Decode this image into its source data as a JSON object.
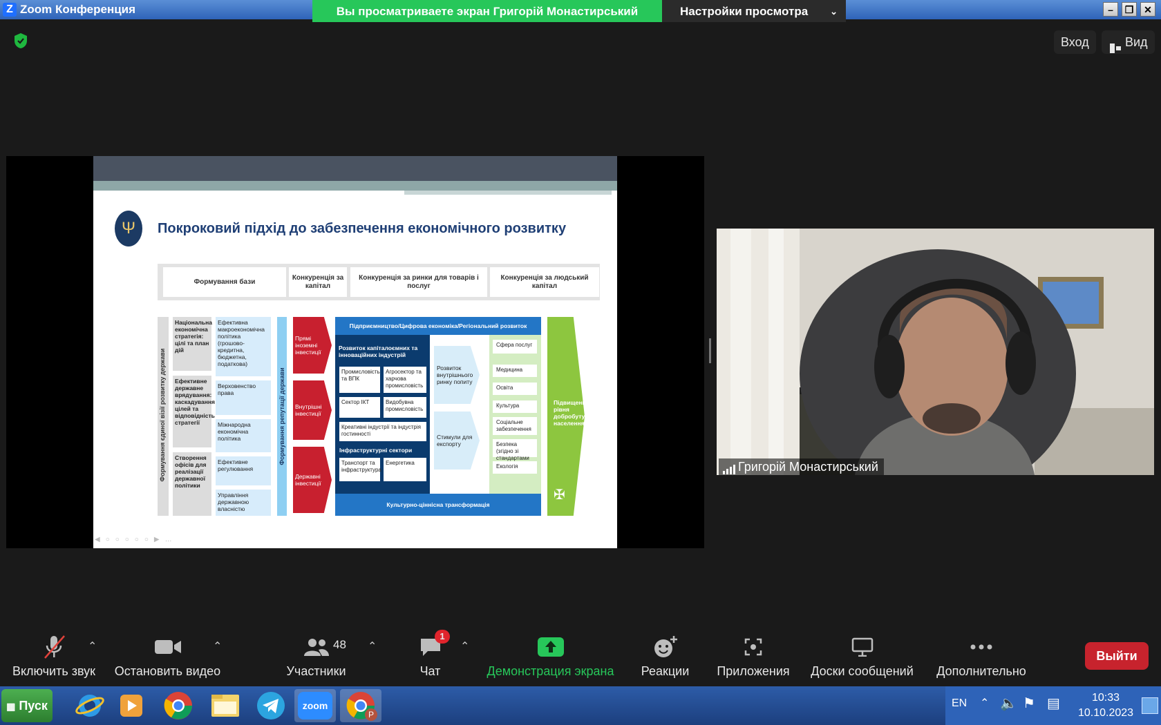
{
  "window": {
    "title": "Zoom Конференция",
    "viewing_banner": "Вы просматриваете экран Григорій Монастирський",
    "view_options": "Настройки просмотра",
    "sign_in": "Вход",
    "view": "Вид"
  },
  "slide": {
    "title": "Покроковий підхід до забезпечення економічного розвитку",
    "stages": [
      "Формування бази",
      "Конкуренція за капітал",
      "Конкуренція за ринки для товарів і послуг",
      "Конкуренція за людський капітал"
    ],
    "left_vertical": "Формування єдиної візії розвитку держави",
    "grey_boxes": [
      "Національна економічна стратегія: цілі та план дій",
      "Ефективне державне врядування: каскадування цілей та відповідність стратегії",
      "Створення офісів для реалізації державної політики"
    ],
    "blue_boxes": [
      "Ефективна макроекономічна політика (грошово-кредитна, бюджетна, податкова)",
      "Верховенство права",
      "Міжнародна економічна політика",
      "Ефективне регулювання",
      "Управління державною власністю"
    ],
    "reputation_vertical": "Формування репутації держави",
    "red_arrows": [
      "Прямі іноземні інвестиції",
      "Внутрішні інвестиції",
      "Державні інвестиції"
    ],
    "header_blue": "Підприємництво/Цифрова економіка/Регіональний розвиток",
    "dev_title": "Розвиток капіталоємних та інноваційних індустрій",
    "dev_boxes": [
      "Промисловість та ВПК",
      "Агросектор та харчова промисловість",
      "Сектор ІКТ",
      "Видобувна промисловість",
      "Креативні індустрії та індустрія гостинності"
    ],
    "infra_title": "Інфраструктурні сектори",
    "infra_boxes": [
      "Транспорт та інфраструктура",
      "Енергетика"
    ],
    "light_arrows": [
      "Розвиток внутрішнього ринку попиту",
      "Стимули для експорту"
    ],
    "services": [
      "Сфера послуг",
      "Медицина",
      "Освіта",
      "Культура",
      "Соціальне забезпечення",
      "Безпека (згідно зі стандартами НАТО)",
      "Екологія"
    ],
    "green_arrow": "Підвищення рівня добробуту населення",
    "footer_blue": "Культурно-ціннісна трансформація"
  },
  "video": {
    "participant_name": "Григорій Монастирський"
  },
  "toolbar": {
    "mic_label": "Включить звук",
    "video_label": "Остановить видео",
    "participants_label": "Участники",
    "participants_count": "48",
    "chat_label": "Чат",
    "chat_badge": "1",
    "share_label": "Демонстрация экрана",
    "reactions_label": "Реакции",
    "apps_label": "Приложения",
    "whiteboards_label": "Доски сообщений",
    "more_label": "Дополнительно",
    "leave_label": "Выйти"
  },
  "taskbar": {
    "start_label": "Пуск",
    "apps": [
      "internet-explorer-icon",
      "media-player-icon",
      "chrome-icon",
      "file-explorer-icon",
      "telegram-icon",
      "zoom-icon",
      "chrome-profile-icon"
    ],
    "zoom_label": "zoom",
    "profile_letter": "P",
    "lang": "EN",
    "time": "10:33",
    "date": "10.10.2023"
  },
  "colors": {
    "banner_green": "#27c75a",
    "share_button_green": "#27c75a",
    "leave_red": "#c7232d",
    "slide_title_blue": "#1f3f75"
  }
}
